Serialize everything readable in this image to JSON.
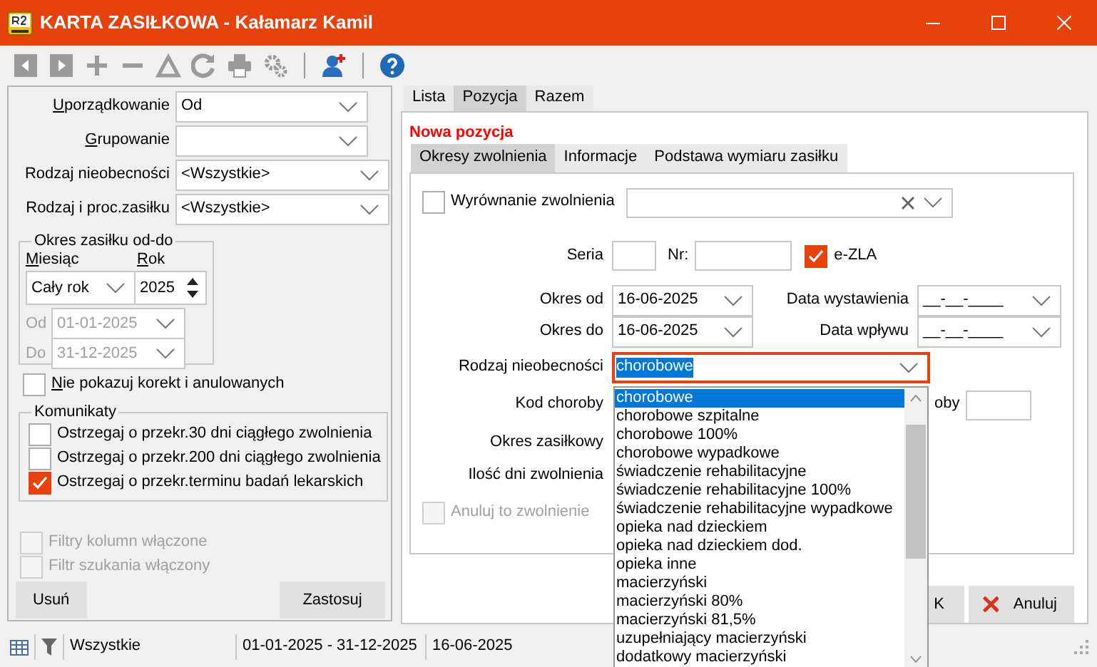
{
  "window": {
    "title": "KARTA ZASIŁKOWA - Kałamarz Kamil"
  },
  "toolbar": [
    {
      "kind": "prev",
      "disabled": true
    },
    {
      "kind": "next",
      "disabled": true
    },
    {
      "kind": "add",
      "disabled": true
    },
    {
      "kind": "remove",
      "disabled": true
    },
    {
      "kind": "delta",
      "disabled": true
    },
    {
      "kind": "refresh",
      "disabled": true
    },
    {
      "kind": "print",
      "disabled": true
    },
    {
      "kind": "gears",
      "disabled": true
    },
    {
      "kind": "separator"
    },
    {
      "kind": "add-person",
      "disabled": false
    },
    {
      "kind": "separator"
    },
    {
      "kind": "help",
      "disabled": false
    }
  ],
  "filters": {
    "combos": [
      {
        "label": "Uporządkowanie",
        "accelerator": true,
        "value": "Od"
      },
      {
        "label": "Grupowanie",
        "accelerator": true
      },
      {
        "label": "Rodzaj nieobecności",
        "accelerator": false,
        "value": "<Wszystkie>"
      },
      {
        "label": "Rodzaj i proc.zasiłku",
        "accelerator": false,
        "value": "<Wszystkie>"
      }
    ],
    "period": {
      "title": "Okres zasiłku od-do",
      "month_label": "Miesiąc",
      "year_label": "Rok",
      "month": "Cały rok",
      "year": "2025",
      "from_label": "Od",
      "from": "01-01-2025",
      "to_label": "Do",
      "to": "31-12-2025",
      "range_disabled": true
    },
    "hide_corrections": {
      "label": "Nie pokazuj korekt i anulowanych",
      "checked": false
    },
    "messages": {
      "title": "Komunikaty",
      "items": [
        {
          "label": "Ostrzegaj o przekr.30 dni ciągłego zwolnienia",
          "checked": false
        },
        {
          "label": "Ostrzegaj o przekr.200 dni ciągłego zwolnienia",
          "checked": false
        },
        {
          "label": "Ostrzegaj o przekr.terminu badań lekarskich",
          "checked": true
        }
      ]
    },
    "column_filters": [
      {
        "label": "Filtry kolumn włączone",
        "checked": false,
        "disabled": true
      },
      {
        "label": "Filtr szukania włączony",
        "checked": false,
        "disabled": true
      }
    ],
    "buttons": [
      "Usuń",
      "Zastosuj"
    ]
  },
  "tabs": [
    {
      "label": "Lista",
      "selected": false
    },
    {
      "label": "Pozycja",
      "selected": true
    },
    {
      "label": "Razem",
      "selected": false
    }
  ],
  "record": {
    "heading": "Nowa pozycja",
    "tabs": [
      {
        "label": "Okresy zwolnienia",
        "selected": true
      },
      {
        "label": "Informacje",
        "selected": false
      },
      {
        "label": "Podstawa wymiaru zasiłku",
        "selected": false
      }
    ],
    "adjustment": {
      "label": "Wyrównanie zwolnienia",
      "checked": false
    },
    "series_label": "Seria",
    "number_label": "Nr:",
    "ezla": {
      "label": "e-ZLA",
      "checked": true
    },
    "period_from": {
      "label": "Okres od",
      "value": "16-06-2025"
    },
    "issue_date": {
      "label": "Data wystawienia",
      "value": "__-__-____"
    },
    "period_to": {
      "label": "Okres do",
      "value": "16-06-2025"
    },
    "receipt_date": {
      "label": "Data wpływu",
      "value": "__-__-____"
    },
    "absence_type": {
      "label": "Rodzaj nieobecności",
      "value": "chorobowe",
      "focused": true
    },
    "options": [
      {
        "label": "chorobowe",
        "selected": true
      },
      {
        "label": "chorobowe szpitalne",
        "selected": false
      },
      {
        "label": "chorobowe 100%",
        "selected": false
      },
      {
        "label": "chorobowe wypadkowe",
        "selected": false
      },
      {
        "label": "świadczenie rehabilitacyjne",
        "selected": false
      },
      {
        "label": "świadczenie rehabilitacyjne 100%",
        "selected": false
      },
      {
        "label": "świadczenie rehabilitacyjne wypadkowe",
        "selected": false
      },
      {
        "label": "opieka nad dzieckiem",
        "selected": false
      },
      {
        "label": "opieka nad dzieckiem dod.",
        "selected": false
      },
      {
        "label": "opieka inne",
        "selected": false
      },
      {
        "label": "macierzyński",
        "selected": false
      },
      {
        "label": "macierzyński 80%",
        "selected": false
      },
      {
        "label": "macierzyński 81,5%",
        "selected": false
      },
      {
        "label": "uzupełniający macierzyński",
        "selected": false
      },
      {
        "label": "dodatkowy macierzyński",
        "selected": false
      }
    ],
    "disease_code_label": "Kod choroby",
    "covered_label": "oby",
    "benefit_period_label": "Okres zasiłkowy",
    "days_label": "Ilość dni zwolnienia",
    "cancel_leave": {
      "label": "Anuluj to zwolnienie",
      "checked": false,
      "disabled": true
    },
    "buttons": [
      {
        "kind": "ok",
        "label": "K"
      },
      {
        "kind": "cancel",
        "label": "Anuluj"
      }
    ]
  },
  "status_bar": {
    "filter": "Wszystkie",
    "range": "01-01-2025 - 31-12-2025",
    "date": "16-06-2025"
  }
}
